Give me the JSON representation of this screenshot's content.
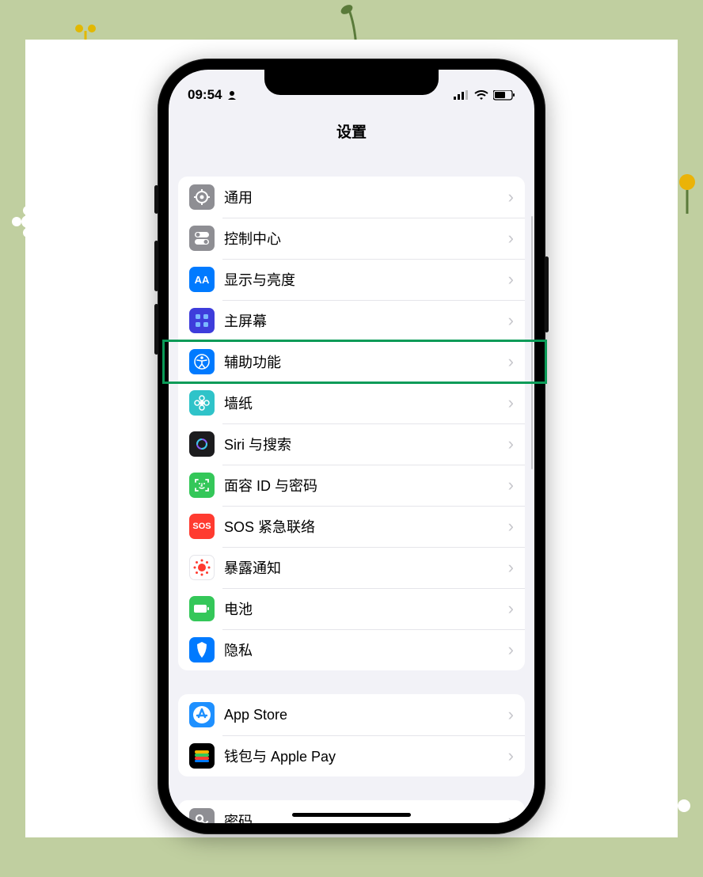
{
  "status": {
    "time": "09:54",
    "signal": 3,
    "wifi": true,
    "battery": 60
  },
  "page_title": "设置",
  "groups": [
    {
      "rows": [
        {
          "icon": "gear-icon",
          "label": "通用",
          "icon_bg": "bg-gray"
        },
        {
          "icon": "toggles-icon",
          "label": "控制中心",
          "icon_bg": "bg-gray2"
        },
        {
          "icon": "display-icon",
          "label": "显示与亮度",
          "icon_bg": "bg-blue",
          "icon_text": "AA"
        },
        {
          "icon": "homescreen-icon",
          "label": "主屏幕",
          "icon_bg": "bg-indigo"
        },
        {
          "icon": "accessibility-icon",
          "label": "辅助功能",
          "icon_bg": "bg-acc",
          "highlighted": true
        },
        {
          "icon": "wallpaper-icon",
          "label": "墙纸",
          "icon_bg": "bg-cyan"
        },
        {
          "icon": "siri-icon",
          "label": "Siri 与搜索",
          "icon_bg": "bg-black"
        },
        {
          "icon": "faceid-icon",
          "label": "面容 ID 与密码",
          "icon_bg": "bg-green"
        },
        {
          "icon": "sos-icon",
          "label": "SOS 紧急联络",
          "icon_bg": "bg-red",
          "icon_text": "SOS"
        },
        {
          "icon": "exposure-icon",
          "label": "暴露通知",
          "icon_bg": "bg-white"
        },
        {
          "icon": "battery-icon",
          "label": "电池",
          "icon_bg": "bg-batt"
        },
        {
          "icon": "privacy-icon",
          "label": "隐私",
          "icon_bg": "bg-priv"
        }
      ]
    },
    {
      "rows": [
        {
          "icon": "appstore-icon",
          "label": "App Store",
          "icon_bg": "bg-appstore"
        },
        {
          "icon": "wallet-icon",
          "label": "钱包与 Apple Pay",
          "icon_bg": "bg-wallet"
        }
      ]
    },
    {
      "rows": [
        {
          "icon": "passwords-icon",
          "label": "密码",
          "icon_bg": "bg-pwd"
        }
      ]
    }
  ]
}
